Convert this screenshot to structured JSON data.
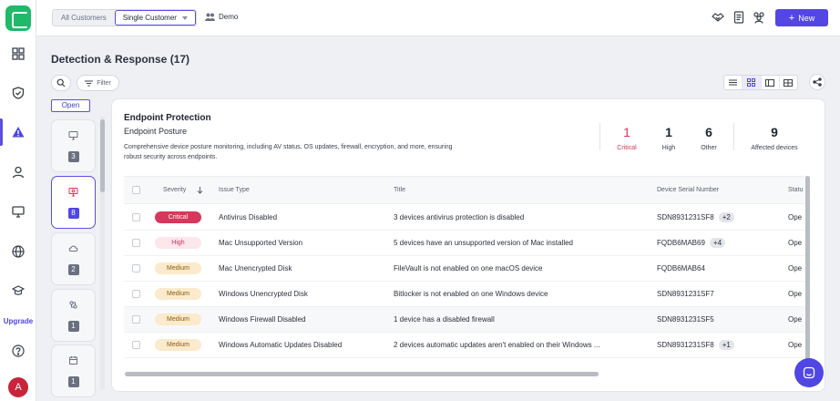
{
  "topbar": {
    "seg_all": "All Customers",
    "seg_single": "Single Customer",
    "customer": "Demo",
    "new_button": "New",
    "icons": [
      "handshake-icon",
      "document-icon",
      "team-icon"
    ]
  },
  "sidebar": {
    "items": [
      "dashboard-icon",
      "shield-check-icon",
      "alert-triangle-icon",
      "user-icon",
      "monitor-icon",
      "globe-icon",
      "graduation-cap-icon"
    ],
    "active": "alert-triangle-icon",
    "upgrade": "Upgrade",
    "avatar": "A",
    "help_icon": "help-circle-icon"
  },
  "page": {
    "title": "Detection & Response (17)",
    "filter": "Filter",
    "open_tab": "Open"
  },
  "categories": [
    {
      "icon": "monitor-icon",
      "count": "3",
      "selected": false
    },
    {
      "icon": "laptop-shield-icon",
      "count": "8",
      "selected": true
    },
    {
      "icon": "cloud-icon",
      "count": "2",
      "selected": false
    },
    {
      "icon": "integration-icon",
      "count": "1",
      "selected": false
    },
    {
      "icon": "calendar-icon",
      "count": "1",
      "selected": false
    }
  ],
  "panel": {
    "title": "Endpoint Protection",
    "subtitle": "Endpoint Posture",
    "description": "Comprehensive device posture monitoring, including AV status, OS updates, firewall, encryption, and more, ensuring robust security across endpoints.",
    "stats": [
      {
        "value": "1",
        "label": "Critical"
      },
      {
        "value": "1",
        "label": "High"
      },
      {
        "value": "6",
        "label": "Other"
      },
      {
        "value": "9",
        "label": "Affected devices"
      }
    ]
  },
  "table": {
    "headers": {
      "severity": "Severity",
      "issue": "Issue Type",
      "title": "Title",
      "serial": "Device Serial Number",
      "status": "Statu"
    },
    "rows": [
      {
        "severity": "Critical",
        "issue": "Antivirus Disabled",
        "title": "3 devices antivirus protection is disabled",
        "serial": "SDN8931231SF8",
        "more": "+2",
        "status": "Ope"
      },
      {
        "severity": "High",
        "issue": "Mac Unsupported Version",
        "title": "5 devices have an unsupported version of Mac installed",
        "serial": "FQDB6MAB69",
        "more": "+4",
        "status": "Ope"
      },
      {
        "severity": "Medium",
        "issue": "Mac Unencrypted Disk",
        "title": "FileVault is not enabled on one macOS device",
        "serial": "FQDB6MAB64",
        "more": "",
        "status": "Ope"
      },
      {
        "severity": "Medium",
        "issue": "Windows Unencrypted Disk",
        "title": "Bitlocker is not enabled on one Windows device",
        "serial": "SDN8931231SF7",
        "more": "",
        "status": "Ope"
      },
      {
        "severity": "Medium",
        "issue": "Windows Firewall Disabled",
        "title": "1 device has a disabled firewall",
        "serial": "SDN8931231SF5",
        "more": "",
        "status": "Ope"
      },
      {
        "severity": "Medium",
        "issue": "Windows Automatic Updates Disabled",
        "title": "2 devices automatic updates aren't enabled on their Windows ...",
        "serial": "SDN8931231SF8",
        "more": "+1",
        "status": "Ope"
      }
    ]
  }
}
